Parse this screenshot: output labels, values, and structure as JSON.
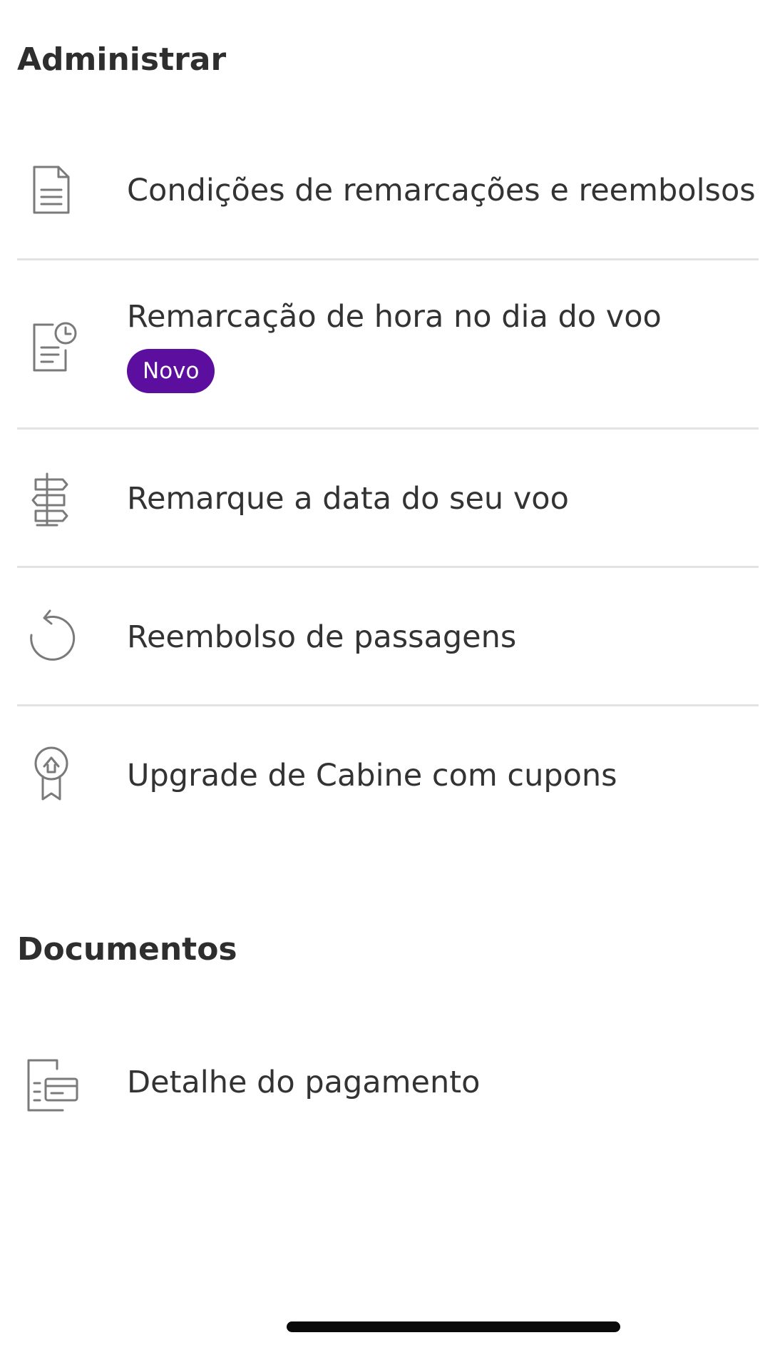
{
  "administrar": {
    "title": "Administrar",
    "items": [
      {
        "icon": "document-list-icon",
        "label": "Condições de remarcações e reembolsos"
      },
      {
        "icon": "document-clock-icon",
        "label": "Remarcação de hora no dia do voo",
        "badge": "Novo"
      },
      {
        "icon": "signpost-icon",
        "label": "Remarque a data do seu voo"
      },
      {
        "icon": "undo-arrow-icon",
        "label": "Reembolso de passagens"
      },
      {
        "icon": "award-ribbon-icon",
        "label": "Upgrade de Cabine com cupons"
      }
    ]
  },
  "documentos": {
    "title": "Documentos",
    "items": [
      {
        "icon": "payment-document-icon",
        "label": "Detalhe do pagamento"
      }
    ]
  },
  "colors": {
    "badge_background": "#5c0f9e",
    "icon_stroke": "#7a7a7a",
    "divider": "#e3e3e3"
  }
}
